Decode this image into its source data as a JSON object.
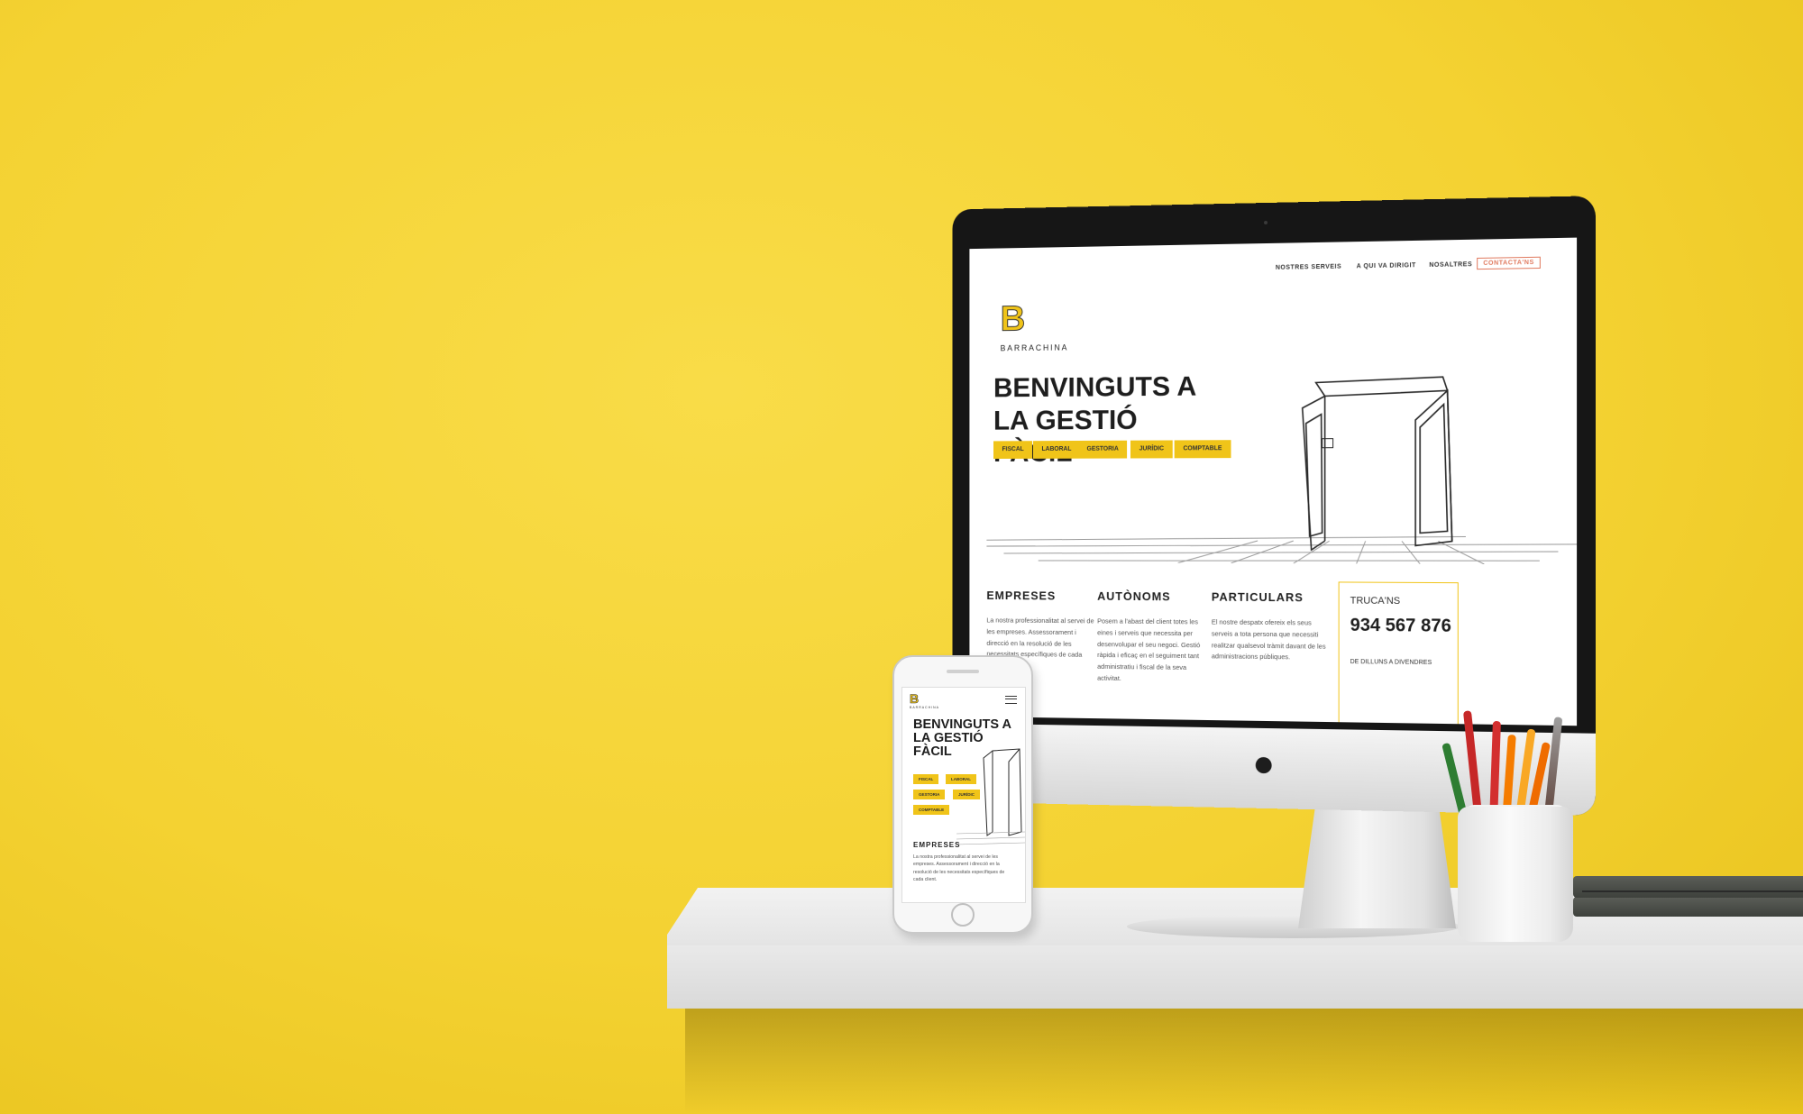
{
  "desktop_site": {
    "nav": {
      "items": [
        "NOSTRES SERVEIS",
        "A QUI VA DIRIGIT",
        "NOSALTRES"
      ],
      "contact_label": "CONTACTA'NS"
    },
    "logo": {
      "mark": "B",
      "name": "BARRACHINA"
    },
    "hero": {
      "title": "BENVINGUTS A LA GESTIÓ FÀCIL",
      "tags": [
        "FISCAL",
        "LABORAL",
        "GESTORIA",
        "JURÍDIC",
        "COMPTABLE"
      ]
    },
    "columns": [
      {
        "title": "EMPRESES",
        "text": "La nostra professionalitat al servei de les empreses. Assessorament i direcció en la resolució de les necessitats específiques de cada client."
      },
      {
        "title": "AUTÒNOMS",
        "text": "Posem a l'abast del client totes les eines i serveis que necessita per desenvolupar el seu negoci. Gestió ràpida i eficaç en el seguiment tant administratiu i fiscal de la seva activitat."
      },
      {
        "title": "PARTICULARS",
        "text": "El nostre despatx ofereix els seus serveis a tota persona que necessiti realitzar qualsevol tràmit davant de les administracions públiques."
      }
    ],
    "contact_box": {
      "label": "TRUCA'NS",
      "phone": "934 567 876",
      "hours": "DE DILLUNS A DIVENDRES"
    }
  },
  "mobile_site": {
    "logo": {
      "mark": "B",
      "name": "BARRACHINA"
    },
    "menu_icon": "hamburger-menu-icon",
    "hero": {
      "title": "BENVINGUTS A LA GESTIÓ FÀCIL",
      "tags": [
        "FISCAL",
        "LABORAL",
        "GESTORIA",
        "JURÍDIC",
        "COMPTABLE"
      ]
    },
    "section": {
      "title": "EMPRESES",
      "text": "La nostra professionalitat al servei de les empreses. Assessorament i direcció en la resolució de les necessitats específiques de cada client."
    }
  },
  "scene": {
    "background_color": "#f5d331",
    "accent_color": "#f0c419",
    "device_icon": "apple-logo-icon",
    "pen_colors": [
      "#2e7d32",
      "#c62828",
      "#d32f2f",
      "#f57c00",
      "#f9a825",
      "#ef6c00",
      "#9e9e9e",
      "#5d4037"
    ]
  }
}
